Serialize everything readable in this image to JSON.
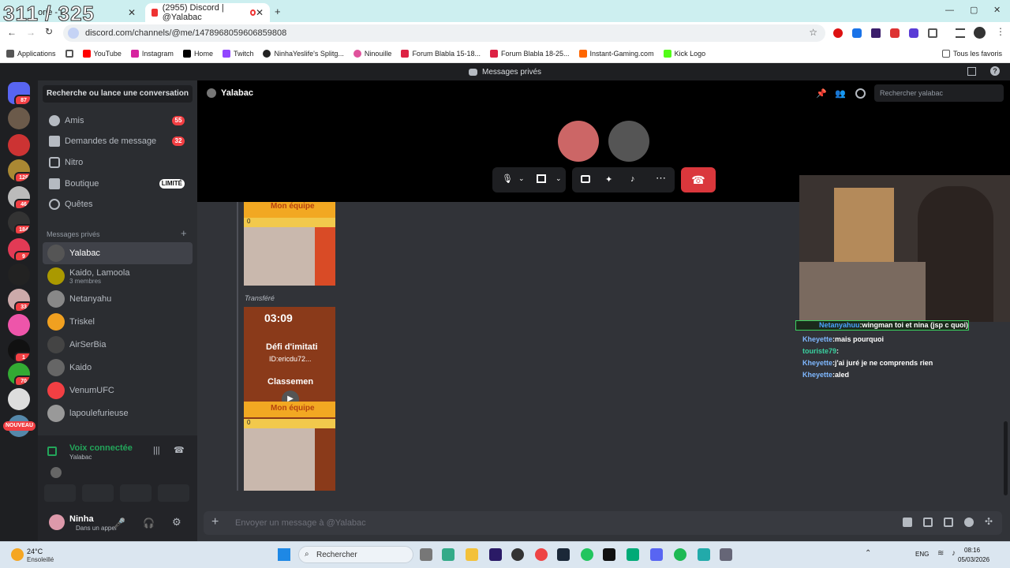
{
  "overlay_counter": "311 / 325",
  "browser": {
    "tabs": [
      {
        "label": "orie - l",
        "active": false
      },
      {
        "label": "(2955) Discord | @Yalabac",
        "active": true
      }
    ],
    "url": "discord.com/channels/@me/1478968059606859808",
    "bookmarks": [
      "Applications",
      "YouTube",
      "Instagram",
      "Home",
      "Twitch",
      "NinhaYeslife's Splitg...",
      "Ninouille",
      "Forum Blabla 15-18...",
      "Forum Blabla 18-25...",
      "Instant-Gaming.com",
      "Kick Logo"
    ],
    "all_favorites": "Tous les favoris"
  },
  "discord": {
    "window_title": "Messages privés",
    "guild_badges": [
      "87",
      "126",
      "46",
      "184",
      "9",
      "33",
      "1",
      "70",
      "NOUVEAU"
    ],
    "search_button": "Recherche ou lance une conversation",
    "nav": [
      {
        "label": "Amis",
        "badge": "55"
      },
      {
        "label": "Demandes de message",
        "badge": "32"
      },
      {
        "label": "Nitro",
        "badge": ""
      },
      {
        "label": "Boutique",
        "badge": "LIMITÉ"
      },
      {
        "label": "Quêtes",
        "badge": ""
      }
    ],
    "dm_header": "Messages privés",
    "dms": [
      {
        "name": "Yalabac",
        "sub": ""
      },
      {
        "name": "Kaido, Lamoola",
        "sub": "3 membres"
      },
      {
        "name": "Netanyahu",
        "sub": ""
      },
      {
        "name": "Triskel",
        "sub": ""
      },
      {
        "name": "AirSerBia",
        "sub": ""
      },
      {
        "name": "Kaido",
        "sub": ""
      },
      {
        "name": "VenumUFC",
        "sub": ""
      },
      {
        "name": "lapoulefurieuse",
        "sub": ""
      }
    ],
    "voice": {
      "status": "Voix connectée",
      "channel": "Yalabac"
    },
    "user": {
      "name": "Ninha",
      "status": "Dans un appel"
    },
    "channel_name": "Yalabac",
    "channel_search_placeholder": "Rechercher yalabac",
    "forwarded_label": "Transféré",
    "card": {
      "team_label": "Mon équipe",
      "score": "0",
      "timer": "03:09",
      "challenge": "Défi d'imitati",
      "id": "ID:ericdu72...",
      "ranking": "Classemen"
    },
    "composer_placeholder": "Envoyer un message à @Yalabac"
  },
  "stream_chat": [
    {
      "user": "Netanyahuu",
      "text": "wingman toi et nina (jsp c quoi)",
      "color": "#4aa3ff"
    },
    {
      "user": "Kheyette",
      "text": "mais pourquoi",
      "color": "#7fb8ff"
    },
    {
      "user": "touriste79",
      "text": "",
      "color": "#3ad1a0"
    },
    {
      "user": "Kheyette",
      "text": "j'ai juré je ne comprends rien",
      "color": "#7fb8ff"
    },
    {
      "user": "Kheyette",
      "text": "aled",
      "color": "#7fb8ff"
    }
  ],
  "taskbar": {
    "weather_temp": "24°C",
    "weather_desc": "Ensoleillé",
    "search": "Rechercher",
    "lang": "ENG",
    "time": "08:16",
    "date": "05/03/2026"
  },
  "colors": {
    "discord_red": "#f23f43",
    "discord_green": "#23a55a",
    "accent": "#5865f2"
  }
}
